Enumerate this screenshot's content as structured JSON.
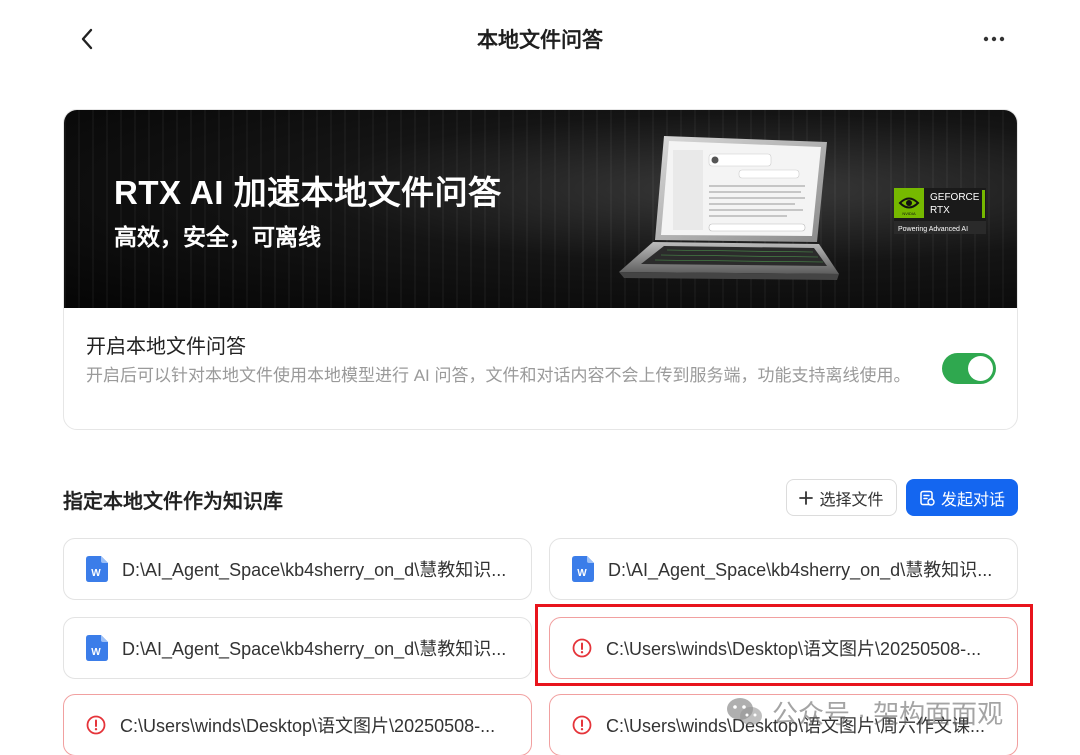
{
  "header": {
    "title": "本地文件问答"
  },
  "banner": {
    "title": "RTX AI 加速本地文件问答",
    "subtitle": "高效，安全，可离线",
    "badge_line1": "GEFORCE",
    "badge_line2": "RTX",
    "badge_line3": "Powering Advanced AI",
    "badge_brand": "NVIDIA"
  },
  "toggle": {
    "title": "开启本地文件问答",
    "description": "开启后可以针对本地文件使用本地模型进行 AI 问答，文件和对话内容不会上传到服务端，功能支持离线使用。",
    "enabled": true,
    "color": "#2fa84f"
  },
  "knowledge": {
    "section_title": "指定本地文件作为知识库",
    "select_label": "选择文件",
    "start_label": "发起对话",
    "accent": "#1466f0",
    "files": [
      {
        "path": "D:\\AI_Agent_Space\\kb4sherry_on_d\\慧教知识...",
        "status": "ok",
        "icon": "word-icon"
      },
      {
        "path": "D:\\AI_Agent_Space\\kb4sherry_on_d\\慧教知识...",
        "status": "ok",
        "icon": "word-icon"
      },
      {
        "path": "D:\\AI_Agent_Space\\kb4sherry_on_d\\慧教知识...",
        "status": "ok",
        "icon": "word-icon"
      },
      {
        "path": "C:\\Users\\winds\\Desktop\\语文图片\\20250508-...",
        "status": "error",
        "icon": "error-icon"
      },
      {
        "path": "C:\\Users\\winds\\Desktop\\语文图片\\20250508-...",
        "status": "error",
        "icon": "error-icon"
      },
      {
        "path": "C:\\Users\\winds\\Desktop\\语文图片\\周六作文课...",
        "status": "error",
        "icon": "error-icon"
      }
    ]
  },
  "watermark": {
    "text": "公众号 · 架构面面观"
  }
}
